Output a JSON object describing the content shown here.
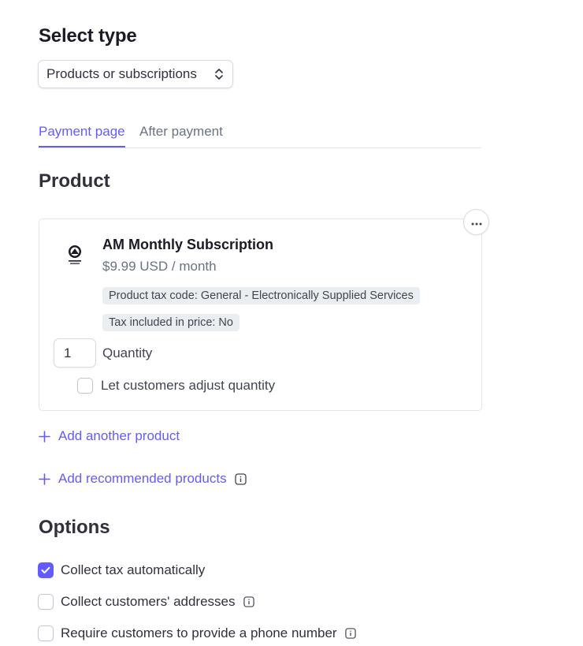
{
  "select_type": {
    "heading": "Select type",
    "selected_value": "Products or subscriptions"
  },
  "tabs": [
    {
      "label": "Payment page",
      "active": true
    },
    {
      "label": "After payment",
      "active": false
    }
  ],
  "product_section": {
    "heading": "Product",
    "product": {
      "name": "AM Monthly Subscription",
      "price": "$9.99 USD / month",
      "tax_code_pill": "Product tax code: General - Electronically Supplied Services",
      "tax_included_pill": "Tax included in price: No",
      "quantity_value": "1",
      "quantity_label": "Quantity",
      "adjust_quantity_label": "Let customers adjust quantity",
      "adjust_quantity_checked": false
    },
    "add_another_product": "Add another product",
    "add_recommended_products": "Add recommended products"
  },
  "options_section": {
    "heading": "Options",
    "items": [
      {
        "label": "Collect tax automatically",
        "checked": true,
        "has_info": false
      },
      {
        "label": "Collect customers' addresses",
        "checked": false,
        "has_info": true
      },
      {
        "label": "Require customers to provide a phone number",
        "checked": false,
        "has_info": true
      }
    ]
  },
  "colors": {
    "accent": "#635bff",
    "text_primary": "#1a1b25",
    "text_secondary": "#6a7383",
    "pill_bg": "#ebeef1",
    "border": "#e3e6ea"
  },
  "icons": {
    "select_chevron": "chevron-up-down-icon",
    "more": "more-horizontal-icon",
    "add": "plus-icon",
    "info": "info-icon",
    "check": "checkmark-icon",
    "product_logo": "product-logo-image"
  }
}
